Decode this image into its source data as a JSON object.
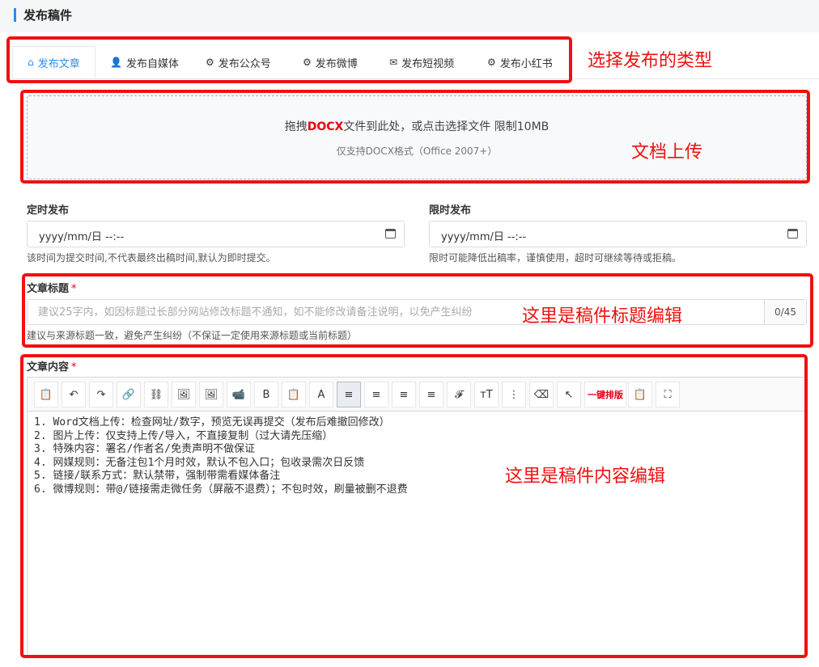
{
  "header": {
    "title": "发布稿件"
  },
  "tabs": [
    {
      "label": "发布文章",
      "icon": "home-icon",
      "active": true
    },
    {
      "label": "发布自媒体",
      "icon": "user-icon",
      "active": false
    },
    {
      "label": "发布公众号",
      "icon": "gear-icon",
      "active": false
    },
    {
      "label": "发布微博",
      "icon": "gear-icon",
      "active": false
    },
    {
      "label": "发布短视频",
      "icon": "envelope-icon",
      "active": false
    },
    {
      "label": "发布小红书",
      "icon": "gear-icon",
      "active": false
    }
  ],
  "annotations": {
    "tabs_note": "选择发布的类型",
    "upload_note": "文档上传",
    "title_note": "这里是稿件标题编辑",
    "content_note": "这里是稿件内容编辑"
  },
  "upload": {
    "prefix": "拖拽",
    "format": "DOCX",
    "suffix": "文件到此处，或点击选择文件 限制10MB",
    "subtext": "仅支持DOCX格式（Office 2007+）"
  },
  "schedule": {
    "label": "定时发布",
    "value": "yyyy/mm/日 --:--",
    "hint": "该时间为提交时间,不代表最终出稿时间,默认为即时提交。"
  },
  "deadline": {
    "label": "限时发布",
    "value": "yyyy/mm/日 --:--",
    "hint": "限时可能降低出稿率，谨慎使用，超时可继续等待或拒稿。"
  },
  "article_title": {
    "label": "文章标题",
    "required_mark": "*",
    "placeholder": "建议25字内，如因标题过长部分网站修改标题不通知，如不能修改请备注说明，以免产生纠纷",
    "counter": "0/45",
    "hint": "建议与来源标题一致，避免产生纠纷（不保证一定使用来源标题或当前标题）"
  },
  "article_content": {
    "label": "文章内容",
    "required_mark": "*",
    "toolbar": [
      {
        "name": "paste-icon",
        "glyph": "📋"
      },
      {
        "name": "undo-icon",
        "glyph": "↶"
      },
      {
        "name": "redo-icon",
        "glyph": "↷"
      },
      {
        "name": "link-icon",
        "glyph": "🔗"
      },
      {
        "name": "unlink-icon",
        "glyph": "⛓"
      },
      {
        "name": "image-insert-icon",
        "glyph": "🖼"
      },
      {
        "name": "image-upload-icon",
        "glyph": "🖼"
      },
      {
        "name": "video-icon",
        "glyph": "📹"
      },
      {
        "name": "bold-icon",
        "glyph": "B"
      },
      {
        "name": "paste-text-icon",
        "glyph": "📋"
      },
      {
        "name": "font-color-icon",
        "glyph": "A"
      },
      {
        "name": "align-left-icon",
        "glyph": "≡",
        "active": true
      },
      {
        "name": "align-center-icon",
        "glyph": "≡"
      },
      {
        "name": "align-right-icon",
        "glyph": "≡"
      },
      {
        "name": "align-justify-icon",
        "glyph": "≡"
      },
      {
        "name": "font-family-icon",
        "glyph": "𝓕"
      },
      {
        "name": "font-size-icon",
        "glyph": "тT"
      },
      {
        "name": "line-height-icon",
        "glyph": "⋮"
      },
      {
        "name": "eraser-icon",
        "glyph": "⌫"
      },
      {
        "name": "select-icon",
        "glyph": "↖"
      },
      {
        "name": "one-click-format-button",
        "label": "一键排版"
      },
      {
        "name": "paste-plain-icon",
        "glyph": "📋"
      },
      {
        "name": "fullscreen-icon",
        "glyph": "⛶"
      }
    ],
    "lines": [
      "1. Word文档上传：检查网址/数字，预览无误再提交（发布后难撤回修改）",
      "2. 图片上传：仅支持上传/导入，不直接复制（过大请先压缩）",
      "3. 特殊内容：署名/作者名/免责声明不做保证",
      "4. 网媒规则：无备注包1个月时效，默认不包入口；包收录需次日反馈",
      "5. 链接/联系方式：默认禁带，强制带需看媒体备注",
      "6. 微博规则：带@/链接需走微任务（屏蔽不退费）；不包时效，刷量被删不退费"
    ]
  },
  "colors": {
    "accent": "#2d8cf0",
    "annotation": "#ee1111",
    "required": "#e60012"
  }
}
